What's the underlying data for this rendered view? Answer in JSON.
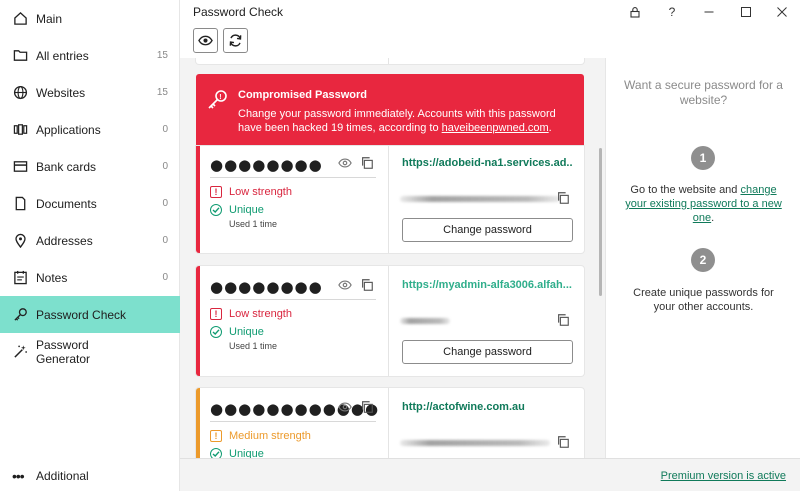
{
  "window": {
    "title": "Password Check"
  },
  "sidebar": {
    "items": [
      {
        "label": "Main",
        "count": "",
        "icon": "home-icon"
      },
      {
        "label": "All entries",
        "count": "15",
        "icon": "folder-icon"
      },
      {
        "label": "Websites",
        "count": "15",
        "icon": "globe-icon"
      },
      {
        "label": "Applications",
        "count": "0",
        "icon": "apps-icon"
      },
      {
        "label": "Bank cards",
        "count": "0",
        "icon": "card-icon"
      },
      {
        "label": "Documents",
        "count": "0",
        "icon": "document-icon"
      },
      {
        "label": "Addresses",
        "count": "0",
        "icon": "location-icon"
      },
      {
        "label": "Notes",
        "count": "0",
        "icon": "notes-icon"
      },
      {
        "label": "Password Check",
        "count": "",
        "icon": "key-icon",
        "active": true
      },
      {
        "label": "Password Generator",
        "count": "",
        "icon": "wand-icon"
      }
    ],
    "additional_label": "Additional"
  },
  "banner": {
    "title": "Compromised Password",
    "text_before": "Change your password immediately. Accounts with this password have been hacked 19 times, according to ",
    "link": "haveibeenpwned.com",
    "text_after": "."
  },
  "entries": [
    {
      "password_mask": "●●●●●●●●",
      "strength": "Low strength",
      "strength_color": "#d9263f",
      "uniqueness": "Unique",
      "used": "Used 1 time",
      "url": "https://adobeid-na1.services.ad...",
      "action": "Change password"
    },
    {
      "password_mask": "●●●●●●●●",
      "strength": "Low strength",
      "strength_color": "#d9263f",
      "uniqueness": "Unique",
      "used": "Used 1 time",
      "url": "https://myadmin-alfa3006.alfah...",
      "action": "Change password"
    },
    {
      "password_mask": "●●●●●●●●●●●●",
      "strength": "Medium strength",
      "strength_color": "#ec9a2b",
      "uniqueness": "Unique",
      "url": "http://actofwine.com.au"
    }
  ],
  "right_panel": {
    "title": "Want a secure password for a website?",
    "step1_number": "1",
    "step1_text": "Go to the website and ",
    "step1_link": "change your existing password to a new one",
    "step1_end": ".",
    "step2_number": "2",
    "step2_text": "Create unique passwords for your other accounts."
  },
  "footer": {
    "premium": "Premium version is active"
  },
  "colors": {
    "accent": "#7de0cd",
    "danger": "#e8273f",
    "success": "#0f9b71",
    "link": "#107a5a"
  }
}
